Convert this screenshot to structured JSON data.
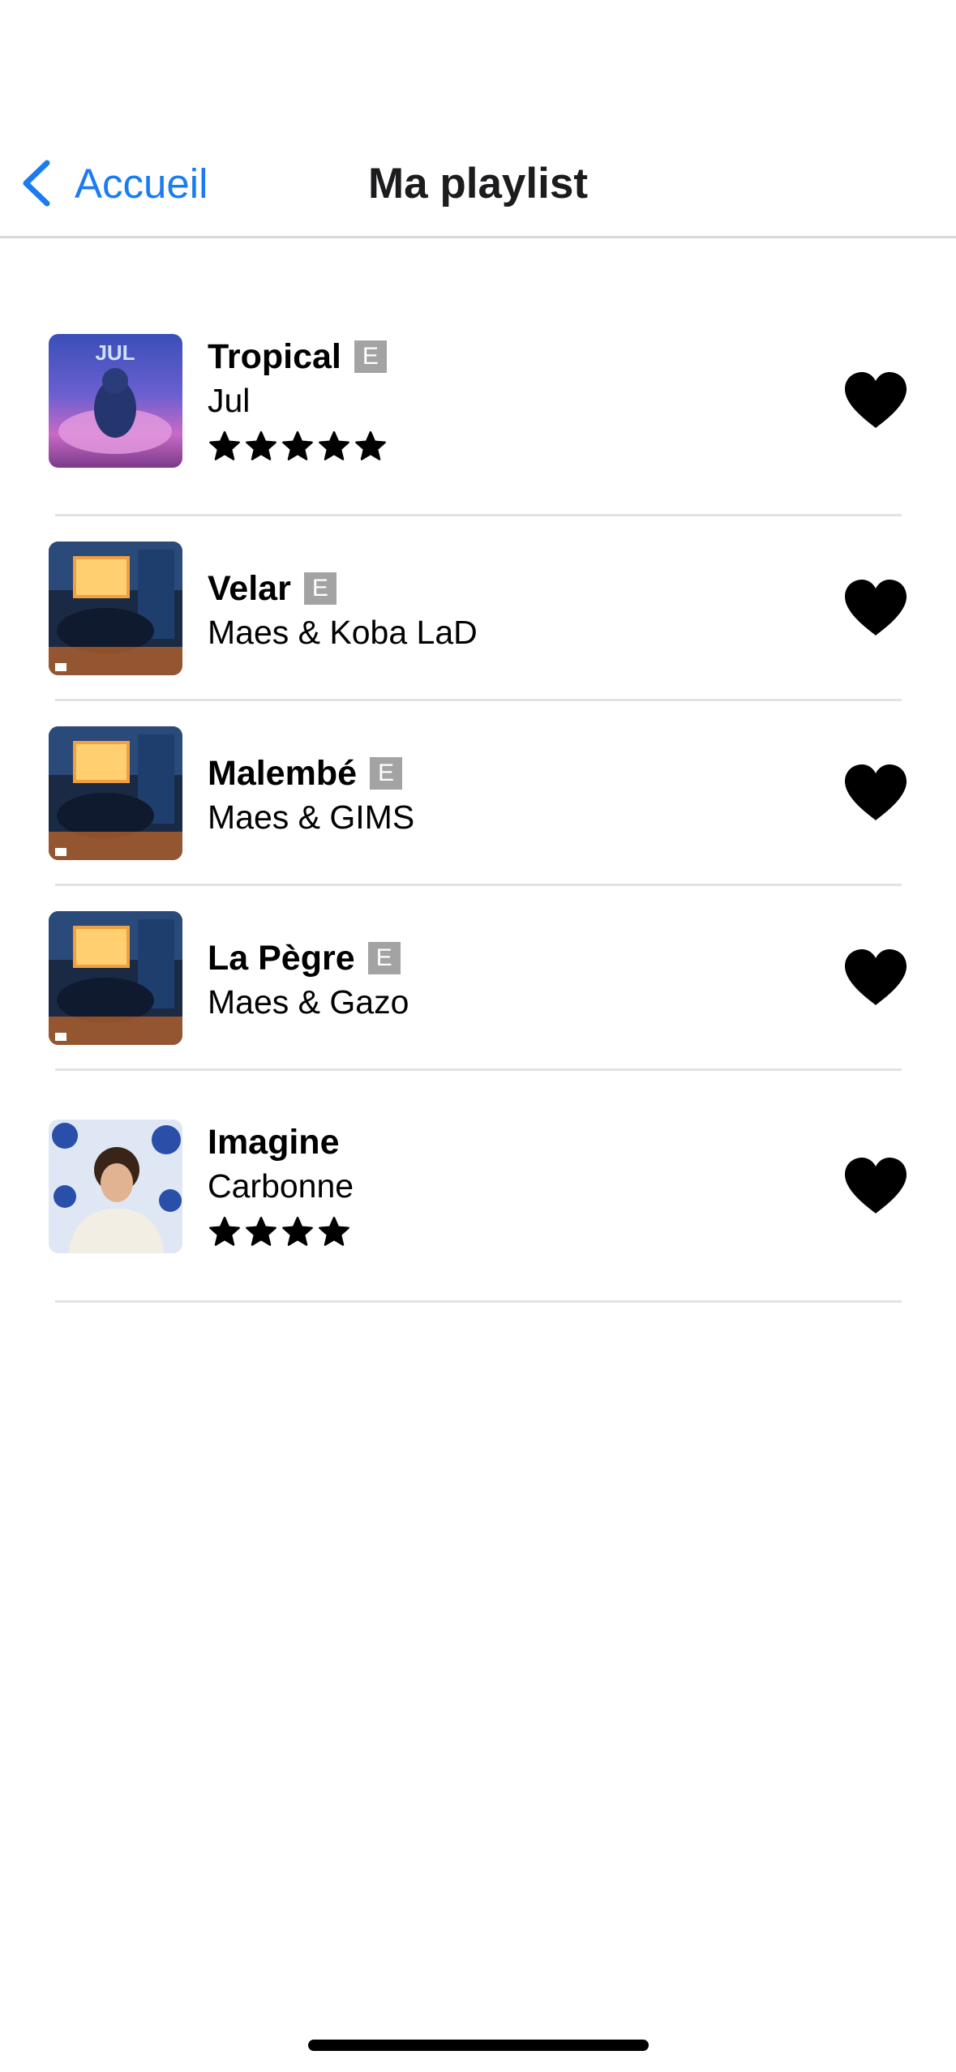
{
  "nav": {
    "back_label": "Accueil",
    "back_icon": "chevron-left-icon",
    "title": "Ma playlist"
  },
  "colors": {
    "accent": "#1a7cf0",
    "explicit_badge": "#a3a3a3",
    "divider": "#e2e2e2"
  },
  "tracks": [
    {
      "title": "Tropical",
      "explicit": true,
      "explicit_label": "E",
      "artist": "Jul",
      "rating": 5,
      "favorite": true
    },
    {
      "title": "Velar",
      "explicit": true,
      "explicit_label": "E",
      "artist": "Maes & Koba LaD",
      "rating": 0,
      "favorite": true
    },
    {
      "title": "Malembé",
      "explicit": true,
      "explicit_label": "E",
      "artist": "Maes & GIMS",
      "rating": 0,
      "favorite": true
    },
    {
      "title": "La Pègre",
      "explicit": true,
      "explicit_label": "E",
      "artist": "Maes & Gazo",
      "rating": 0,
      "favorite": true
    },
    {
      "title": "Imagine",
      "explicit": false,
      "explicit_label": "",
      "artist": "Carbonne",
      "rating": 4,
      "favorite": true
    }
  ]
}
